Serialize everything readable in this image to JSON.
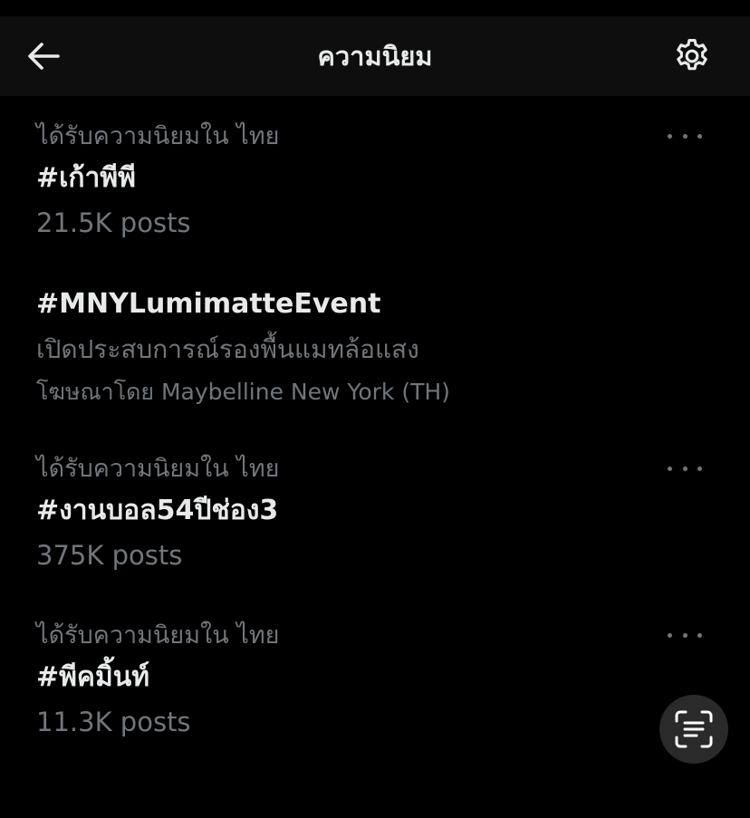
{
  "header": {
    "title": "ความนิยม",
    "back_icon": "arrow-left-icon",
    "settings_icon": "gear-icon"
  },
  "trends": [
    {
      "context": "ได้รับความนิยมใน ไทย",
      "name": "#เก้าพีพี",
      "posts": "21.5K posts"
    },
    {
      "name": "#MNYLumimatteEvent",
      "description": "เปิดประสบการณ์รองพื้นแมทล้อแสง",
      "promoted": "โฆษณาโดย Maybelline New York (TH)"
    },
    {
      "context": "ได้รับความนิยมใน ไทย",
      "name": "#งานบอล54ปีช่อง3",
      "posts": "375K posts"
    },
    {
      "context": "ได้รับความนิยมใน ไทย",
      "name": "#พีคมิ้นท์",
      "posts": "11.3K posts"
    }
  ],
  "floating": {
    "icon": "text-scan-icon"
  },
  "colors": {
    "background": "#000000",
    "header_background": "#0e0e0e",
    "primary_text": "#e7e9ea",
    "secondary_text": "#71767b",
    "fab_background": "#2a2a2a"
  }
}
